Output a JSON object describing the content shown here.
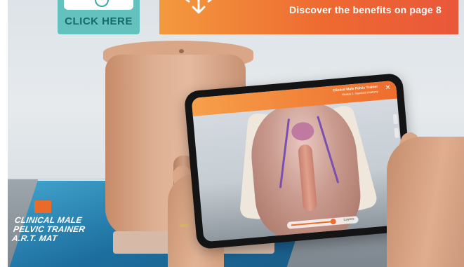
{
  "header": {
    "click_here_label": "CLICK HERE",
    "banner_text": "Discover the benefits on page 8"
  },
  "mat": {
    "title_line1": "CLINICAL MALE",
    "title_line2": "PELVIC TRAINER",
    "title_line3": "A.R.T. MAT"
  },
  "tablet_app": {
    "title": "Clinical Male Pelvic Trainer",
    "subtitle": "Module 1: Standard Anatomy",
    "slider_label": "Layers"
  },
  "colors": {
    "banner_start": "#f39a3e",
    "banner_end": "#e9573a",
    "click_here_bg": "#63c2bd",
    "click_here_text": "#196a6a"
  }
}
